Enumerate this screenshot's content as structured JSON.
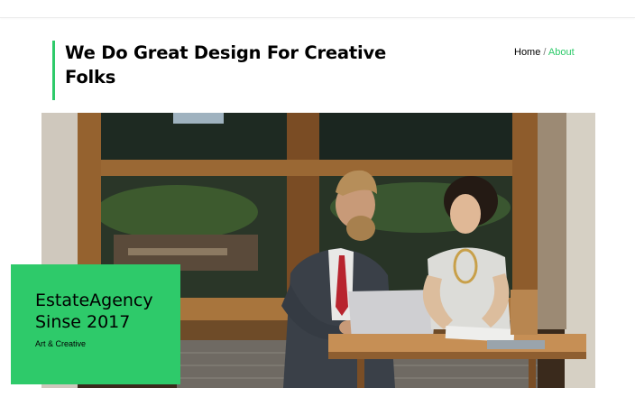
{
  "page": {
    "title": "We Do Great Design For Creative Folks"
  },
  "breadcrumb": {
    "home": "Home",
    "separator": "/",
    "current": "About"
  },
  "hero_image": {
    "subject": "two people working at a wooden table with a laptop"
  },
  "promo": {
    "line1": "EstateAgency",
    "line2": "Sinse 2017",
    "subtitle": "Art & Creative"
  },
  "colors": {
    "accent": "#2eca6a",
    "text": "#000000",
    "background": "#ffffff"
  }
}
